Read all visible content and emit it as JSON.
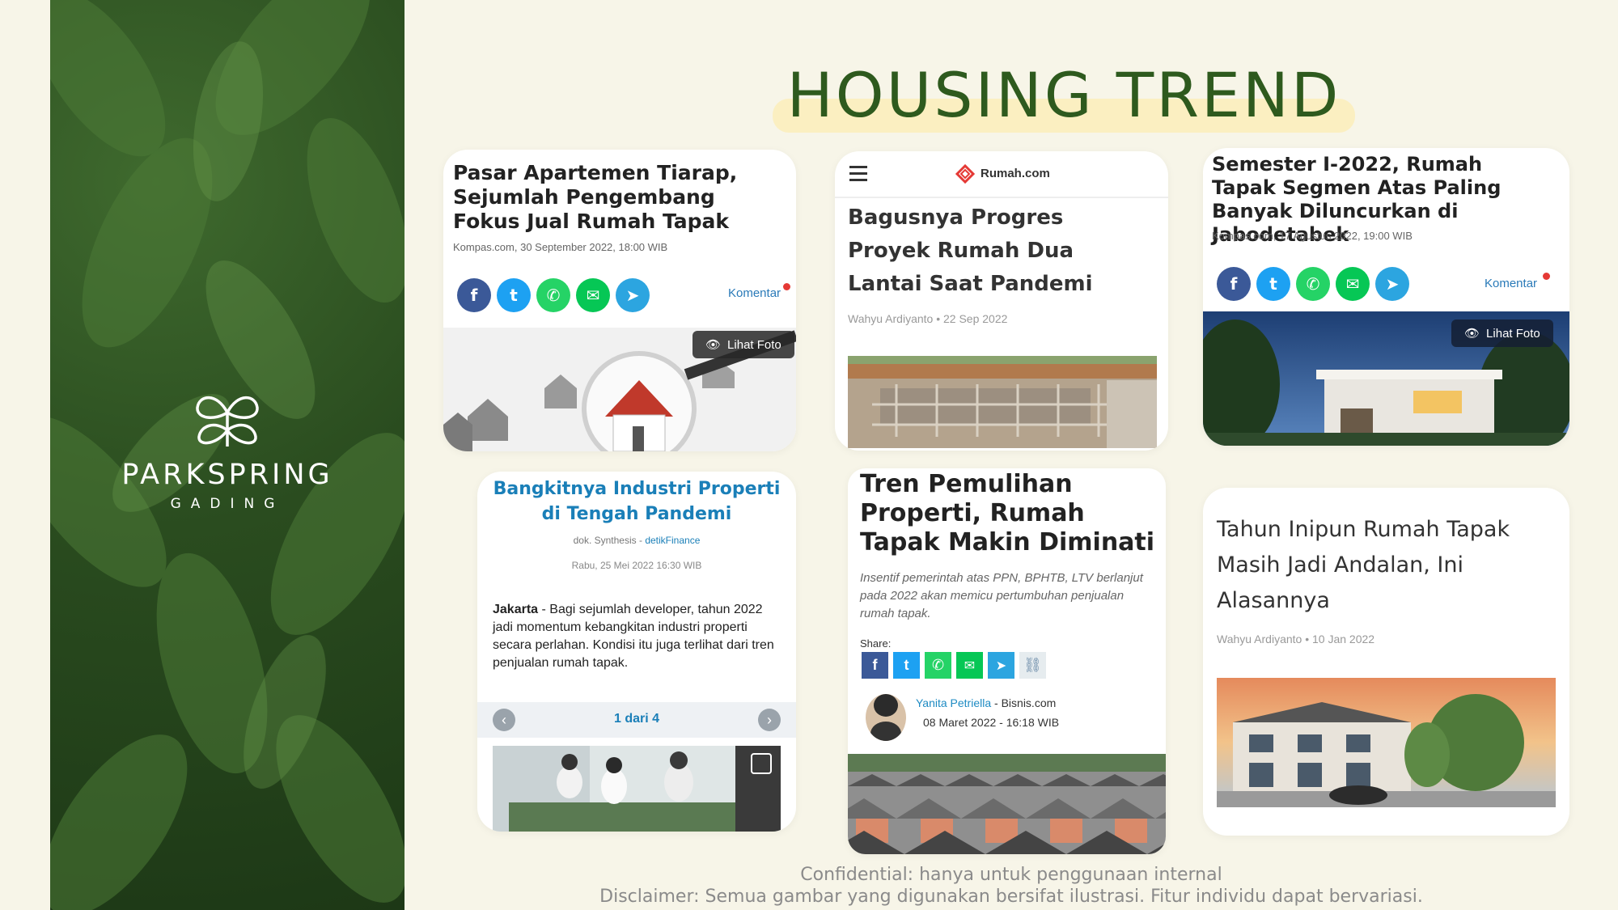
{
  "brand": {
    "name": "PARKSPRING",
    "sub": "GADING"
  },
  "title": "HOUSING TREND",
  "cards": [
    {
      "headline": "Pasar Apartemen Tiarap, Sejumlah Pengembang Fokus Jual Rumah Tapak",
      "meta": "Kompas.com, 30 September 2022, 18:00 WIB",
      "komentar": "Komentar",
      "photo_label": "Lihat Foto"
    },
    {
      "site": "Rumah.com",
      "headline": "Bagusnya Progres Proyek Rumah Dua Lantai Saat Pandemi",
      "meta": "Wahyu Ardiyanto • 22 Sep 2022"
    },
    {
      "headline": "Semester I-2022, Rumah Tapak Segmen Atas Paling Banyak Diluncurkan di Jabodetabek",
      "meta": "Kompas.com, 17 Agustus 2022, 19:00 WIB",
      "komentar": "Komentar",
      "photo_label": "Lihat Foto"
    },
    {
      "headline": "Bangkitnya Industri Properti di Tengah Pandemi",
      "credit_prefix": "dok. Synthesis - ",
      "credit_source": "detikFinance",
      "date": "Rabu, 25 Mei 2022 16:30 WIB",
      "lead": "Jakarta",
      "body": " - Bagi sejumlah developer, tahun 2022 jadi momentum kebangkitan industri properti secara perlahan. Kondisi itu juga terlihat dari tren penjualan rumah tapak.",
      "pager": "1 dari 4"
    },
    {
      "headline": "Tren Pemulihan Properti, Rumah Tapak Makin Diminati",
      "summary": "Insentif pemerintah atas PPN, BPHTB, LTV berlanjut pada 2022 akan memicu pertumbuhan penjualan rumah tapak.",
      "share_label": "Share:",
      "author": "Yanita Petriella",
      "outlet": " - Bisnis.com",
      "date": "08 Maret 2022 - 16:18 WIB"
    },
    {
      "headline": "Tahun Inipun Rumah Tapak Masih Jadi Andalan, Ini Alasannya",
      "meta": "Wahyu Ardiyanto • 10 Jan 2022"
    }
  ],
  "footer": {
    "line1": "Confidential: hanya untuk penggunaan internal",
    "line2": "Disclaimer: Semua gambar yang digunakan bersifat ilustrasi. Fitur individu dapat bervariasi."
  }
}
